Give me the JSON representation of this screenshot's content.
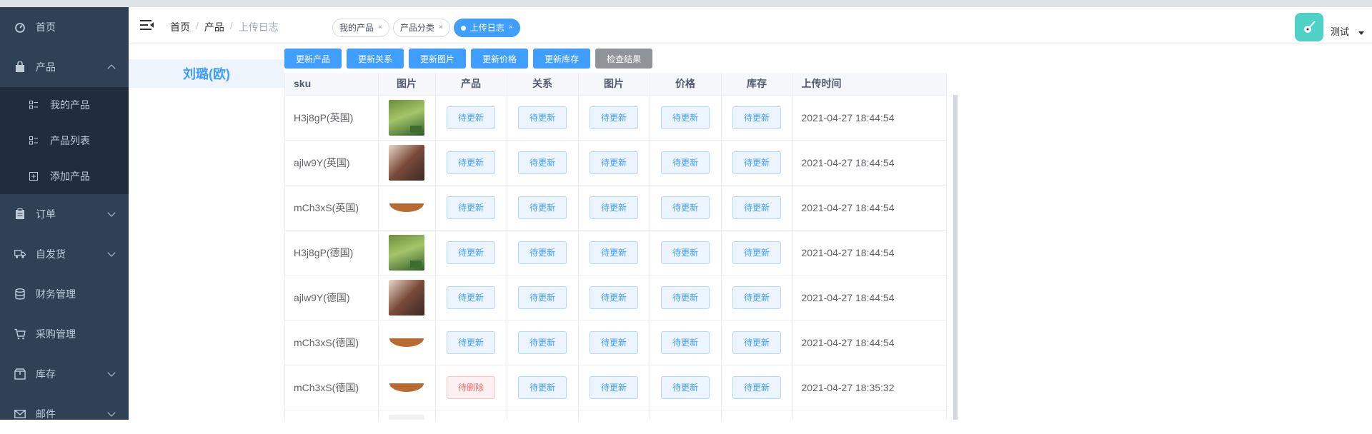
{
  "sidebar": {
    "items": [
      {
        "label": "首页",
        "icon": "dashboard-icon"
      },
      {
        "label": "产品",
        "icon": "bag-icon",
        "expanded": true,
        "children": [
          {
            "label": "我的产品",
            "icon": "list-icon"
          },
          {
            "label": "产品列表",
            "icon": "list-icon"
          },
          {
            "label": "添加产品",
            "icon": "plus-square-icon"
          }
        ]
      },
      {
        "label": "订单",
        "icon": "clipboard-icon"
      },
      {
        "label": "自发货",
        "icon": "truck-icon"
      },
      {
        "label": "财务管理",
        "icon": "database-icon"
      },
      {
        "label": "采购管理",
        "icon": "cart-icon"
      },
      {
        "label": "库存",
        "icon": "box-icon"
      },
      {
        "label": "邮件",
        "icon": "mail-icon"
      }
    ]
  },
  "header": {
    "breadcrumb": [
      "首页",
      "产品",
      "上传日志"
    ],
    "tags": [
      {
        "label": "我的产品",
        "close": "×"
      },
      {
        "label": "产品分类",
        "close": "×"
      },
      {
        "label": "上传日志",
        "close": "×",
        "active": true
      }
    ],
    "user_name": "测试"
  },
  "category": {
    "name": "刘璐(欧)"
  },
  "actions": [
    "更新产品",
    "更新关系",
    "更新图片",
    "更新价格",
    "更新库存",
    "检查结果"
  ],
  "table": {
    "columns": [
      "sku",
      "图片",
      "产品",
      "关系",
      "图片",
      "价格",
      "库存",
      "上传时间"
    ],
    "rows": [
      {
        "sku": "H3j8gP(英国)",
        "image": "garden",
        "product": "待更新",
        "relation": "待更新",
        "picture": "待更新",
        "price": "待更新",
        "stock": "待更新",
        "time": "2021-04-27 18:44:54"
      },
      {
        "sku": "ajlw9Y(英国)",
        "image": "brush",
        "product": "待更新",
        "relation": "待更新",
        "picture": "待更新",
        "price": "待更新",
        "stock": "待更新",
        "time": "2021-04-27 18:44:54"
      },
      {
        "sku": "mCh3xS(英国)",
        "image": "basket",
        "product": "待更新",
        "relation": "待更新",
        "picture": "待更新",
        "price": "待更新",
        "stock": "待更新",
        "time": "2021-04-27 18:44:54"
      },
      {
        "sku": "H3j8gP(德国)",
        "image": "garden",
        "product": "待更新",
        "relation": "待更新",
        "picture": "待更新",
        "price": "待更新",
        "stock": "待更新",
        "time": "2021-04-27 18:44:54"
      },
      {
        "sku": "ajlw9Y(德国)",
        "image": "brush",
        "product": "待更新",
        "relation": "待更新",
        "picture": "待更新",
        "price": "待更新",
        "stock": "待更新",
        "time": "2021-04-27 18:44:54"
      },
      {
        "sku": "mCh3xS(德国)",
        "image": "basket",
        "product": "待更新",
        "relation": "待更新",
        "picture": "待更新",
        "price": "待更新",
        "stock": "待更新",
        "time": "2021-04-27 18:44:54"
      },
      {
        "sku": "mCh3xS(德国)",
        "image": "basket",
        "product": "待删除",
        "product_status": "danger",
        "relation": "待更新",
        "picture": "待更新",
        "price": "待更新",
        "stock": "待更新",
        "time": "2021-04-27 18:35:32"
      }
    ]
  },
  "colors": {
    "primary": "#409eff",
    "sidebar": "#304156",
    "danger": "#f56c6c"
  }
}
